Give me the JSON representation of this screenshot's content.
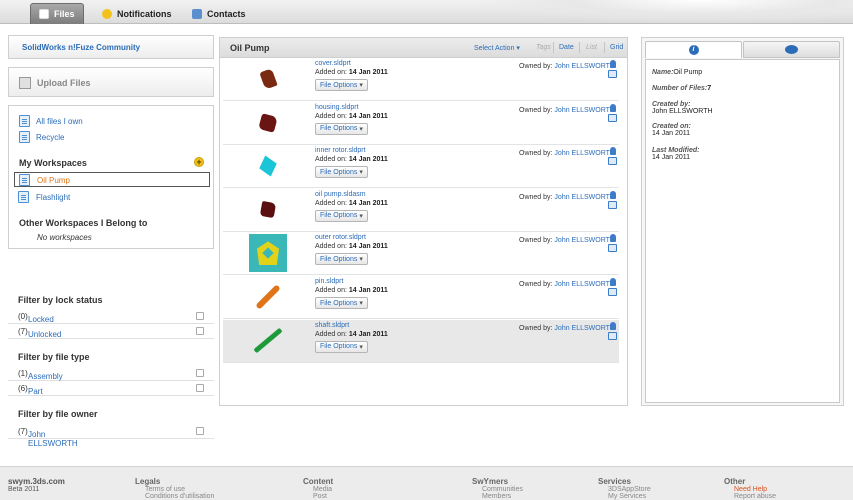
{
  "topbar": {
    "tabs": [
      {
        "label": "Files",
        "active": true
      },
      {
        "label": "Notifications",
        "active": false
      },
      {
        "label": "Contacts",
        "active": false
      }
    ]
  },
  "sidebar": {
    "community_label": "SolidWorks n!Fuze Community",
    "upload_label": "Upload Files",
    "all_files_label": "All files I own",
    "recycle_label": "Recycle",
    "my_workspaces_title": "My Workspaces",
    "workspaces": [
      {
        "label": "Oil Pump",
        "selected": true
      },
      {
        "label": "Flashlight",
        "selected": false
      }
    ],
    "other_workspaces_title": "Other Workspaces I Belong to",
    "no_workspaces_label": "No workspaces"
  },
  "filters": {
    "lock_title": "Filter by lock status",
    "lock_items": [
      {
        "label": "Locked",
        "count": "(0)"
      },
      {
        "label": "Unlocked",
        "count": "(7)"
      }
    ],
    "type_title": "Filter by file type",
    "type_items": [
      {
        "label": "Assembly",
        "count": "(1)"
      },
      {
        "label": "Part",
        "count": "(6)"
      }
    ],
    "owner_title": "Filter by file owner",
    "owner_items": [
      {
        "label": "John ELLSWORTH",
        "count": "(7)"
      }
    ]
  },
  "main": {
    "workspace_title": "Oil Pump",
    "select_action_label": "Select Action",
    "view_tag_label": "Tags",
    "view_date_label": "Date",
    "view_list_label": "List",
    "view_grid_label": "Grid",
    "added_prefix": "Added on:",
    "owner_prefix": "Owned by:",
    "file_options_label": "File Options",
    "files": [
      {
        "name": "cover.sldprt",
        "date": "14 Jan 2011",
        "owner": "John ELLSWORTH",
        "thumb_color": "#7a2a12",
        "selected": false
      },
      {
        "name": "housing.sldprt",
        "date": "14 Jan 2011",
        "owner": "John ELLSWORTH",
        "thumb_color": "#6b1414",
        "selected": false
      },
      {
        "name": "inner rotor.sldprt",
        "date": "14 Jan 2011",
        "owner": "John ELLSWORTH",
        "thumb_color": "#19c5d6",
        "selected": false
      },
      {
        "name": "oil pump.sldasm",
        "date": "14 Jan 2011",
        "owner": "John ELLSWORTH",
        "thumb_color": "#5a1010",
        "selected": false
      },
      {
        "name": "outer rotor.sldprt",
        "date": "14 Jan 2011",
        "owner": "John ELLSWORTH",
        "thumb_color": "#e3d21a",
        "selected": false
      },
      {
        "name": "pin.sldprt",
        "date": "14 Jan 2011",
        "owner": "John ELLSWORTH",
        "thumb_color": "#e07418",
        "selected": false
      },
      {
        "name": "shaft.sldprt",
        "date": "14 Jan 2011",
        "owner": "John ELLSWORTH",
        "thumb_color": "#1e9a3a",
        "selected": true
      }
    ]
  },
  "details": {
    "name_label": "Name:",
    "name_value": "Oil Pump",
    "count_label": "Number of Files:",
    "count_value": "7",
    "created_by_label": "Created by:",
    "created_by_value": "John ELLSWORTH",
    "created_on_label": "Created on:",
    "created_on_value": "14 Jan 2011",
    "modified_label": "Last Modified:",
    "modified_value": "14 Jan 2011"
  },
  "footer": {
    "brand_name": "swym.3ds.com",
    "brand_version": "Beta 2011",
    "columns": [
      {
        "title": "Legals",
        "items": [
          "Terms of use",
          "Conditions d'utilisation"
        ]
      },
      {
        "title": "Content",
        "items": [
          "Media",
          "Post"
        ]
      },
      {
        "title": "SwYmers",
        "items": [
          "Communities",
          "Members"
        ]
      },
      {
        "title": "Services",
        "items": [
          "3DSAppStore",
          "My Services"
        ]
      },
      {
        "title": "Other",
        "items": [
          "Need Help",
          "Report abuse"
        ]
      }
    ]
  },
  "colors": {
    "link": "#2b6cb8",
    "selected_workspace": "#e07418",
    "add_button": "#f2c21a",
    "need_help": "#d9531e"
  }
}
